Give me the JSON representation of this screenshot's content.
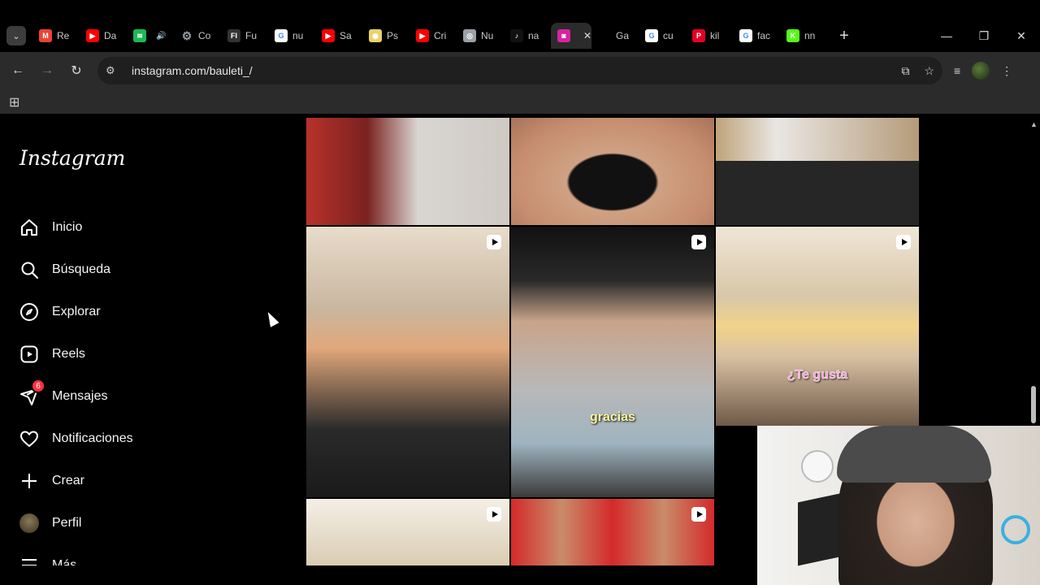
{
  "browser": {
    "tabs": [
      {
        "label": "Re",
        "icon": "gmail-icon",
        "color": "#ea4335"
      },
      {
        "label": "Da",
        "icon": "youtube-icon",
        "color": "#ff0000"
      },
      {
        "label": "",
        "icon": "spotify-icon",
        "color": "#1db954"
      },
      {
        "label": "Co",
        "icon": "settings-icon",
        "color": "#9aa0a6"
      },
      {
        "label": "Fu",
        "icon": "fl-icon",
        "color": "#333333"
      },
      {
        "label": "nu",
        "icon": "google-icon",
        "color": "#4285f4"
      },
      {
        "label": "Sa",
        "icon": "youtube-icon",
        "color": "#ff0000"
      },
      {
        "label": "Ps",
        "icon": "ps-icon",
        "color": "#e8d36a"
      },
      {
        "label": "Cri",
        "icon": "youtube-icon",
        "color": "#ff0000"
      },
      {
        "label": "Nu",
        "icon": "chrome-icon",
        "color": "#9aa0a6"
      },
      {
        "label": "na",
        "icon": "tiktok-icon",
        "color": "#111111"
      },
      {
        "label": "",
        "icon": "instagram-icon",
        "color": "#d6249f",
        "active": true
      },
      {
        "label": "Ga",
        "icon": "blank-icon",
        "color": "#000000"
      },
      {
        "label": "cu",
        "icon": "google-icon",
        "color": "#4285f4"
      },
      {
        "label": "kil",
        "icon": "pinterest-icon",
        "color": "#e60023"
      },
      {
        "label": "fac",
        "icon": "google-icon",
        "color": "#4285f4"
      },
      {
        "label": "nn",
        "icon": "k-icon",
        "color": "#53fc18"
      }
    ],
    "url": "instagram.com/bauleti_/"
  },
  "instagram": {
    "logo": "Instagram",
    "nav": [
      {
        "label": "Inicio",
        "icon": "home-icon"
      },
      {
        "label": "Búsqueda",
        "icon": "search-icon"
      },
      {
        "label": "Explorar",
        "icon": "compass-icon"
      },
      {
        "label": "Reels",
        "icon": "reels-icon"
      },
      {
        "label": "Mensajes",
        "icon": "messenger-icon",
        "badge": "6"
      },
      {
        "label": "Notificaciones",
        "icon": "heart-icon"
      },
      {
        "label": "Crear",
        "icon": "plus-icon"
      },
      {
        "label": "Perfil",
        "icon": "avatar"
      },
      {
        "label": "Más",
        "icon": "menu-icon"
      }
    ],
    "captions": {
      "gracias": "gracias",
      "te_gusta": "¿Te gusta"
    }
  },
  "colors": {
    "background": "#000000",
    "chrome": "#2b2b2b",
    "badge": "#ff3040"
  }
}
